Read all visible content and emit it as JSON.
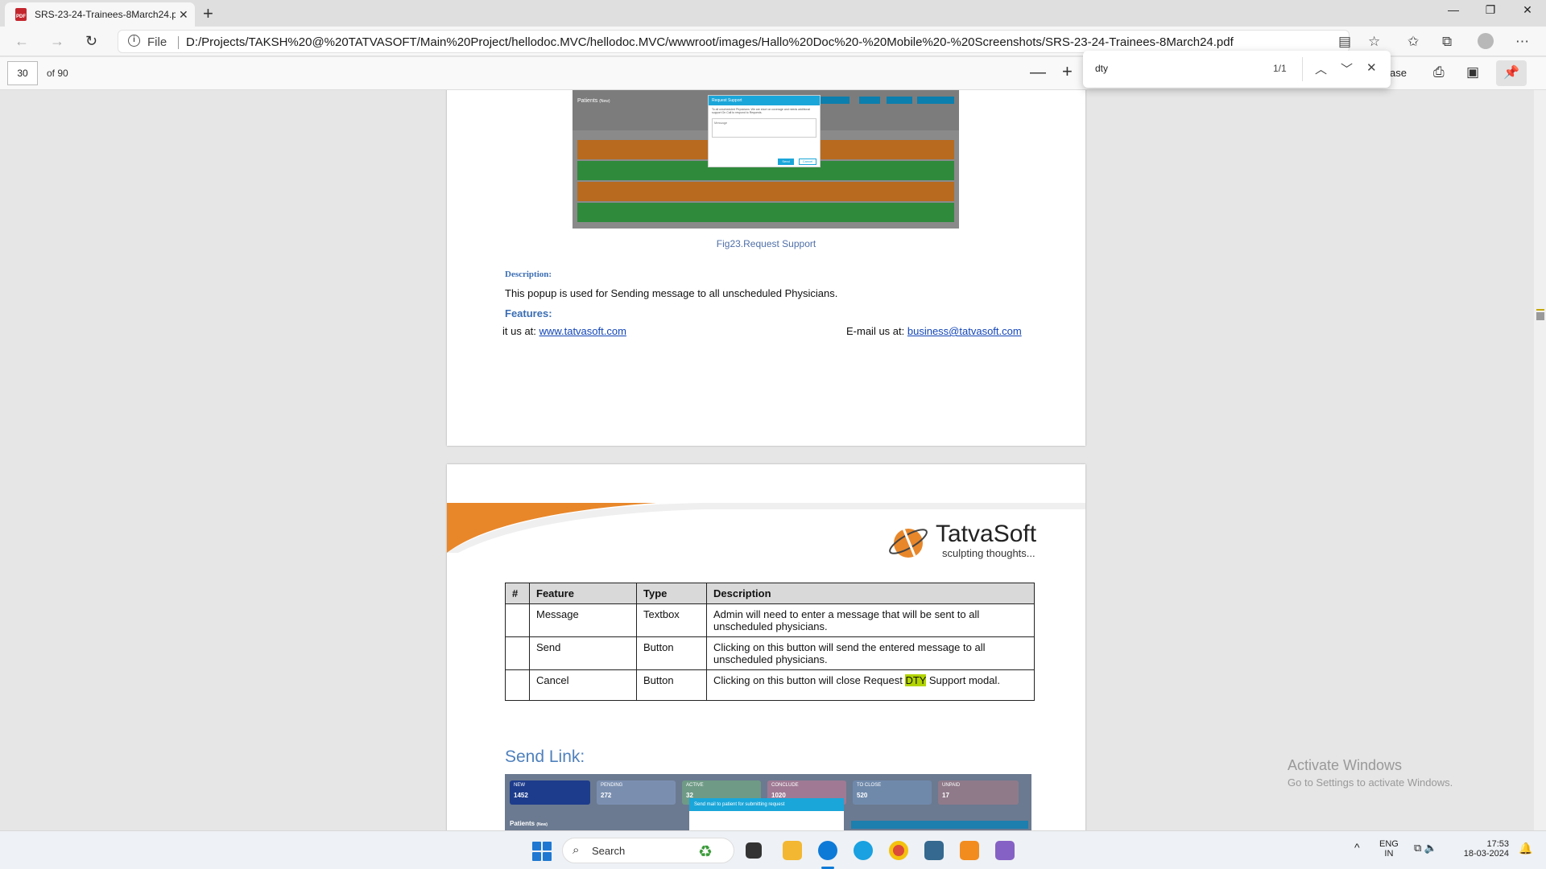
{
  "browser": {
    "tab_title": "SRS-23-24-Trainees-8March24.p",
    "tab_icon_text": "PDF",
    "url_scheme": "File",
    "url": "D:/Projects/TAKSH%20@%20TATVASOFT/Main%20Project/hellodoc.MVC/hellodoc.MVC/wwwroot/images/Hallo%20Doc%20-%20Mobile%20-%20Screenshots/SRS-23-24-Trainees-8March24.pdf"
  },
  "pdf_toolbar": {
    "page_number": "30",
    "page_total": "of 90",
    "hidden_label_fragment": "ase"
  },
  "find_bar": {
    "query": "dty",
    "count": "1/1"
  },
  "page1": {
    "screenshot": {
      "title": "Patients",
      "title_badge": "(New)",
      "modal_title": "Request Support",
      "modal_send": "Send",
      "modal_cancel": "Cancel",
      "modal_text": "To all unscheduled Physicians: We are short on coverage and needs additional support On Call to respond to Requests.",
      "modal_placeholder": "Message"
    },
    "caption": "Fig23.Request Support",
    "description_heading": "Description:",
    "description_text": "This popup is used for Sending message to all unscheduled Physicians.",
    "features_heading": "Features:",
    "footer_visit_label": "it us at:",
    "footer_visit_link": "www.tatvasoft.com",
    "footer_email_label": "E-mail us at:",
    "footer_email_link": "business@tatvasoft.com"
  },
  "page2": {
    "logo_name": "TatvaSoft",
    "logo_tagline": "sculpting thoughts...",
    "table_headers": [
      "#",
      "Feature",
      "Type",
      "Description"
    ],
    "rows": [
      {
        "feature": "Message",
        "type": "Textbox",
        "description": "Admin will need to enter a message that will be sent to all unscheduled physicians."
      },
      {
        "feature": "Send",
        "type": "Button",
        "description": "Clicking on this button will send the entered message to all unscheduled physicians."
      },
      {
        "feature": "Cancel",
        "type": "Button",
        "description_before": "Clicking on this button will close Request ",
        "description_highlight": "DTY",
        "description_after": " Support modal."
      }
    ],
    "section_heading": "Send Link:",
    "screenshot": {
      "cards": [
        {
          "label": "NEW",
          "value": "1452",
          "color": "#1d3c8c"
        },
        {
          "label": "PENDING",
          "value": "272",
          "color": "#7a8fb0"
        },
        {
          "label": "ACTIVE",
          "value": "32",
          "color": "#6f9a86"
        },
        {
          "label": "CONCLUDE",
          "value": "1020",
          "color": "#a07a94"
        },
        {
          "label": "TO CLOSE",
          "value": "520",
          "color": "#6f89ab"
        },
        {
          "label": "UNPAID",
          "value": "17",
          "color": "#8f7a8a"
        }
      ],
      "patients_label": "Patients",
      "patients_badge": "(New)",
      "modal_title": "Send mail to patient for submitting request"
    }
  },
  "watermark": {
    "line1": "Activate Windows",
    "line2": "Go to Settings to activate Windows."
  },
  "taskbar": {
    "search_placeholder": "Search",
    "language": "ENG",
    "region": "IN",
    "time": "17:53",
    "date": "18-03-2024"
  }
}
